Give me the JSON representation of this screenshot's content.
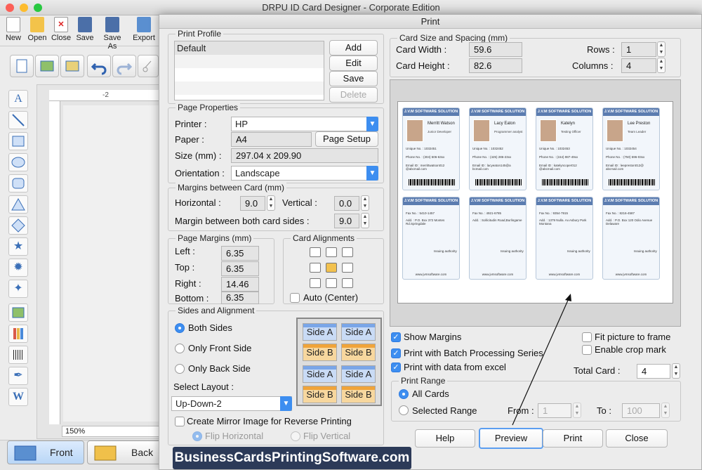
{
  "app": {
    "title": "DRPU ID Card Designer - Corporate Edition",
    "toolbar": [
      "New",
      "Open",
      "Close",
      "Save",
      "Save As",
      "Export"
    ],
    "zoom": "150%",
    "ruler_mark": "-2",
    "tabs": {
      "front": "Front",
      "back": "Back"
    },
    "watermark": "BusinessCardsPrintingSoftware.com"
  },
  "dialog": {
    "title": "Print",
    "print_profile": {
      "label": "Print Profile",
      "items": [
        "Default"
      ],
      "add": "Add",
      "edit": "Edit",
      "save": "Save",
      "delete": "Delete"
    },
    "page_properties": {
      "label": "Page Properties",
      "printer_label": "Printer :",
      "printer": "HP",
      "paper_label": "Paper :",
      "paper": "A4",
      "page_setup": "Page Setup",
      "size_label": "Size (mm) :",
      "size": "297.04 x 209.90",
      "orientation_label": "Orientation :",
      "orientation": "Landscape"
    },
    "margins_card": {
      "label": "Margins between Card (mm)",
      "horizontal_label": "Horizontal :",
      "horizontal": "9.0",
      "vertical_label": "Vertical :",
      "vertical": "0.0",
      "both_label": "Margin between both card sides :",
      "both": "9.0"
    },
    "page_margins": {
      "label": "Page Margins (mm)",
      "left_label": "Left :",
      "left": "6.35",
      "top_label": "Top :",
      "top": "6.35",
      "right_label": "Right :",
      "right": "14.46",
      "bottom_label": "Bottom :",
      "bottom": "6.35"
    },
    "card_alignments": {
      "label": "Card Alignments",
      "auto": "Auto (Center)"
    },
    "sides": {
      "label": "Sides and Alignment",
      "both": "Both Sides",
      "front": "Only Front Side",
      "back": "Only Back Side",
      "layout_label": "Select Layout :",
      "layout": "Up-Down-2",
      "side_a": "Side A",
      "side_b": "Side B",
      "mirror": "Create Mirror Image for Reverse Printing",
      "flip_h": "Flip Horizontal",
      "flip_v": "Flip Vertical"
    },
    "card_size": {
      "label": "Card Size and Spacing (mm)",
      "width_label": "Card Width :",
      "width": "59.6",
      "height_label": "Card Height :",
      "height": "82.6",
      "rows_label": "Rows :",
      "rows": "1",
      "columns_label": "Columns :",
      "columns": "4"
    },
    "options": {
      "show_margins": "Show Margins",
      "batch": "Print with Batch Processing Series",
      "excel": "Print with data from excel",
      "fit": "Fit picture to frame",
      "crop": "Enable crop mark",
      "total_label": "Total Card :",
      "total": "4"
    },
    "print_range": {
      "label": "Print Range",
      "all": "All Cards",
      "selected": "Selected Range",
      "from_label": "From :",
      "from": "1",
      "to_label": "To :",
      "to": "100"
    },
    "buttons": {
      "help": "Help",
      "preview": "Preview",
      "print": "Print",
      "close": "Close"
    },
    "preview_cards": {
      "company": "J.V.M SOFTWARE SOLUTION",
      "unique_label": "Unique No. :",
      "phone_label": "Phone No. :",
      "email_label": "Email ID :",
      "fax_label": "Fax No. :",
      "add_label": "Add. :",
      "authority": "Issuing authority",
      "website": "www.jvmsoftware.com",
      "front": [
        {
          "name": "Merritt Watson",
          "title": "Junior Developer",
          "unique": "1032451",
          "phone": "(304) 506-63xx",
          "email": "merrittwatson012 @abcmail.com"
        },
        {
          "name": "Lacy Eaton",
          "title": "Programmer analyst",
          "unique": "1032452",
          "phone": "(425) 286-23xx",
          "email": "lacyeaton145@a bcmail.com"
        },
        {
          "name": "Katelyn",
          "title": "Testing Officer",
          "unique": "1032453",
          "phone": "(154) 987-49xx",
          "email": "katelyncoper012 @abcmail.com"
        },
        {
          "name": "Lee Preston",
          "title": "Team Leader",
          "unique": "1032454",
          "phone": "(750) 596-03xx",
          "email": "leepreston012@ abcmail.com"
        }
      ],
      "back": [
        {
          "fax": "5410-1457",
          "add": "P.O. Box 372 Montes Rd.Springdale"
        },
        {
          "fax": "4921-6785",
          "add": "Sollicitudin Road,Burlingame"
        },
        {
          "fax": "9354-7915",
          "add": "1379 Nulla. Av.Asbury Park Montana"
        },
        {
          "fax": "8216-4587",
          "add": "P.O. Box 120 Odio Avenue Delaware"
        }
      ]
    }
  }
}
